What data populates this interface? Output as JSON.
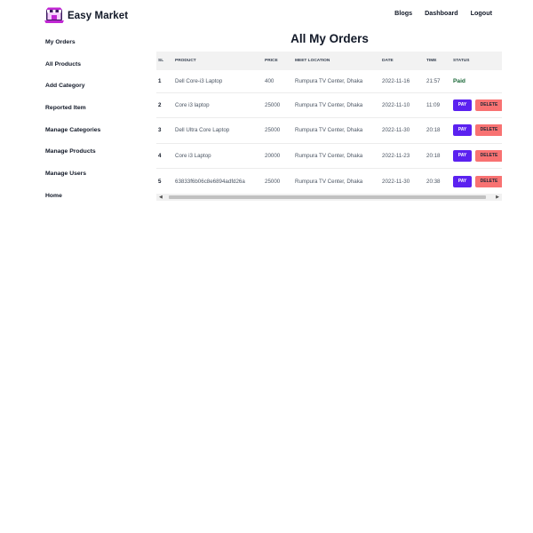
{
  "brand": {
    "name": "Easy Market"
  },
  "nav": {
    "blogs": "Blogs",
    "dashboard": "Dashboard",
    "logout": "Logout"
  },
  "sidebar": {
    "items": [
      {
        "label": "My Orders"
      },
      {
        "label": "All Products"
      },
      {
        "label": "Add Category"
      },
      {
        "label": "Reported Item"
      },
      {
        "label": "Manage Categories"
      },
      {
        "label": "Manage Products"
      },
      {
        "label": "Manage Users"
      },
      {
        "label": "Home"
      }
    ]
  },
  "page": {
    "title": "All My Orders"
  },
  "table": {
    "headers": [
      "SL",
      "PRODUCT",
      "PRICE",
      "MEET LOCATION",
      "DATE",
      "TIME",
      "STATUS"
    ],
    "pay_label": "PAY",
    "delete_label": "DELETE",
    "rows": [
      {
        "sl": "1",
        "product": "Dell Core-i3 Laptop",
        "price": "400",
        "location": "Rumpura TV Center, Dhaka",
        "date": "2022-11-16",
        "time": "21:57",
        "status": "Paid"
      },
      {
        "sl": "2",
        "product": "Core i3 laptop",
        "price": "25000",
        "location": "Rumpura TV Center, Dhaka",
        "date": "2022-11-10",
        "time": "11:09",
        "status": ""
      },
      {
        "sl": "3",
        "product": "Dell Ultra Core Laptop",
        "price": "25000",
        "location": "Rumpura TV Center, Dhaka",
        "date": "2022-11-30",
        "time": "20:18",
        "status": ""
      },
      {
        "sl": "4",
        "product": "Core i3 Laptop",
        "price": "20000",
        "location": "Rumpura TV Center, Dhaka",
        "date": "2022-11-23",
        "time": "20:18",
        "status": ""
      },
      {
        "sl": "5",
        "product": "63833f6b06c8e6894adfd26a",
        "price": "25000",
        "location": "Rumpura TV Center, Dhaka",
        "date": "2022-11-30",
        "time": "20:38",
        "status": ""
      }
    ]
  },
  "colors": {
    "pay": "#5b21f0",
    "delete": "#f87272",
    "paid": "#166534",
    "logo": "#c026d3"
  },
  "icons": {
    "logo": "storefront-laptop-icon",
    "scroll_left": "triangle-left-icon",
    "scroll_right": "triangle-right-icon"
  }
}
